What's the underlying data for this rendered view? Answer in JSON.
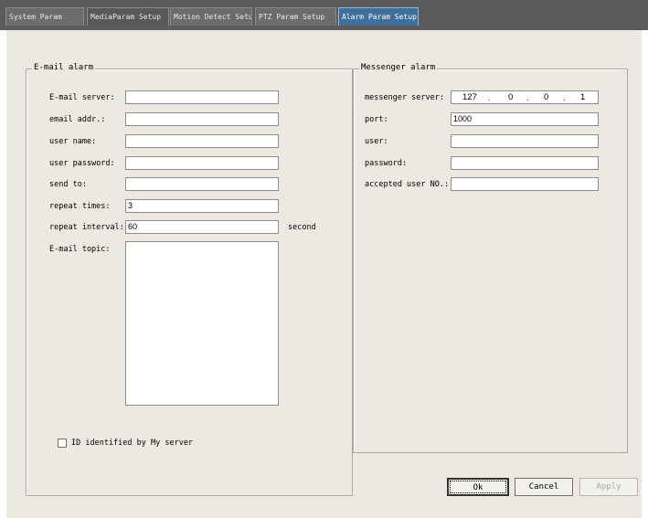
{
  "tabs": [
    {
      "label": "System Param"
    },
    {
      "label": "MediaParam Setup"
    },
    {
      "label": "Motion Detect Setup"
    },
    {
      "label": "PTZ Param Setup"
    },
    {
      "label": "Alarm Param Setup"
    }
  ],
  "email": {
    "legend": "E-mail alarm",
    "server_label": "E-mail server:",
    "server_value": "",
    "addr_label": "email addr.:",
    "addr_value": "",
    "user_label": "user name:",
    "user_value": "",
    "password_label": "user password:",
    "password_value": "",
    "sendto_label": "send to:",
    "sendto_value": "",
    "repeat_times_label": "repeat times:",
    "repeat_times_value": "3",
    "repeat_interval_label": "repeat interval:",
    "repeat_interval_value": "60",
    "interval_unit": "second",
    "topic_label": "E-mail topic:",
    "topic_value": "",
    "checkbox_label": "ID identified by  My server",
    "checkbox_checked": false
  },
  "messenger": {
    "legend": "Messenger alarm",
    "server_label": "messenger server:",
    "ip": [
      "127",
      "0",
      "0",
      "1"
    ],
    "port_label": "port:",
    "port_value": "1000",
    "user_label": "user:",
    "user_value": "",
    "password_label": "password:",
    "password_value": "",
    "accepted_label": "accepted user NO.:",
    "accepted_value": ""
  },
  "buttons": {
    "ok": "Ok",
    "cancel": "Cancel",
    "apply": "Apply"
  },
  "colors": {
    "tabbar": "#5b5b5b",
    "active_tab": "#3f6f9c",
    "dialog_bg": "#ece9e2"
  }
}
